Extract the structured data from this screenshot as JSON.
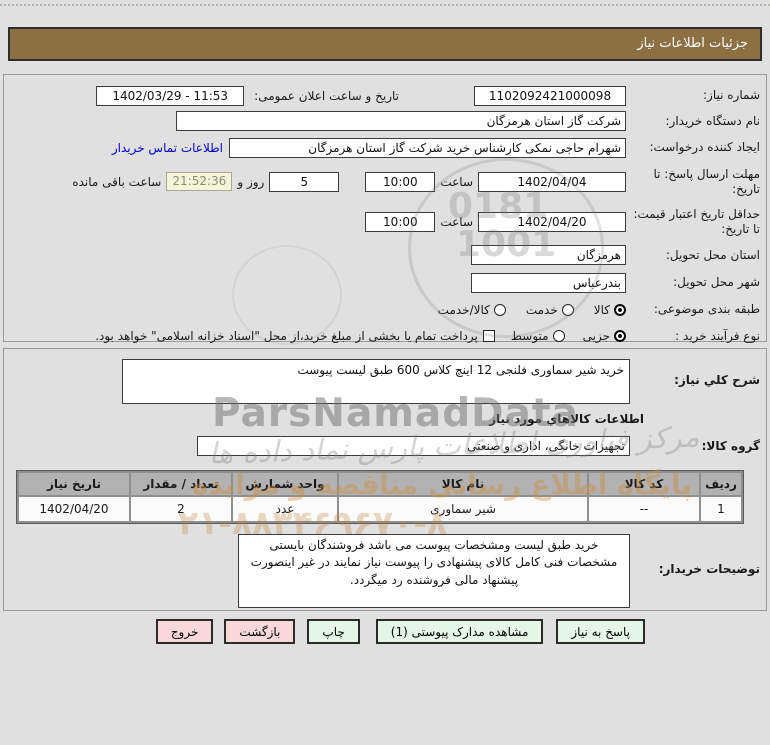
{
  "header": {
    "title": "جزئیات اطلاعات نیاز"
  },
  "need_info": {
    "need_number": {
      "label": "شماره نیاز:",
      "value": "1102092421000098"
    },
    "announce_datetime": {
      "label": "تاریخ و ساعت اعلان عمومی:",
      "value": "1402/03/29 - 11:53"
    },
    "buyer_org": {
      "label": "نام دستگاه خریدار:",
      "value": "شرکت گاز استان هرمزگان"
    },
    "request_creator": {
      "label": "ایجاد کننده درخواست:",
      "value": "شهرام حاجی نمکی کارشناس خرید شرکت گاز استان هرمزگان"
    },
    "contact_link": "اطلاعات تماس خریدار",
    "reply_deadline": {
      "label": "مهلت ارسال پاسخ: تا تاریخ:",
      "date": "1402/04/04",
      "hour_label": "ساعت",
      "time": "10:00",
      "days_remaining": "5",
      "days_label": "روز و",
      "countdown": "21:52:36",
      "countdown_label": "ساعت باقی مانده"
    },
    "price_validity": {
      "label": "حداقل تاریخ اعتبار قیمت: تا تاریخ:",
      "date": "1402/04/20",
      "hour_label": "ساعت",
      "time": "10:00"
    },
    "delivery_province": {
      "label": "استان محل تحویل:",
      "value": "هرمزگان"
    },
    "delivery_city": {
      "label": "شهر محل تحویل:",
      "value": "بندرعباس"
    },
    "subject_class": {
      "label": "طبقه بندی موضوعی:",
      "options": [
        {
          "label": "کالا",
          "selected": true
        },
        {
          "label": "خدمت",
          "selected": false
        },
        {
          "label": "کالا/خدمت",
          "selected": false
        }
      ]
    },
    "purchase_type": {
      "label": "نوع فرآیند خرید :",
      "options": [
        {
          "label": "جزیی",
          "selected": true
        },
        {
          "label": "متوسط",
          "selected": false
        }
      ],
      "treasury_checkbox_label": "پرداخت تمام یا بخشی از مبلغ خرید،از محل \"اسناد خزانه اسلامی\" خواهد بود.",
      "treasury_checked": false
    }
  },
  "need_desc": {
    "label": "شرح کلي نیاز:",
    "value": "خرید شیر سماوری فلنجی 12 اینچ کلاس 600 طبق لیست پیوست"
  },
  "goods_section": {
    "title": "اطلاعات کالاهاي مورد نیاز",
    "group": {
      "label": "گروه کالا:",
      "value": "تجهیزات خانگی، اداری و صنعتی"
    },
    "table": {
      "headers": [
        "ردیف",
        "کد کالا",
        "نام کالا",
        "واحد شمارش",
        "تعداد / مقدار",
        "تاریخ نیاز"
      ],
      "rows": [
        [
          "1",
          "--",
          "شیر سماوری",
          "عدد",
          "2",
          "1402/04/20"
        ]
      ]
    }
  },
  "buyer_notes": {
    "label": "توضیحات خریدار:",
    "value": "خرید طبق لیست ومشخصات پیوست می باشد فروشندگان بایستی مشخصات فنی کامل کالای پیشنهادی را پیوست نیاز نمایند در غیر اینصورت پیشنهاد مالی فروشنده رد میگردد."
  },
  "buttons": {
    "reply": "پاسخ به نیاز",
    "view_docs": "مشاهده مدارک پیوستی (1)",
    "print": "چاپ",
    "back": "بازگشت",
    "exit": "خروج"
  },
  "watermark": {
    "brand": "ParsNamadData",
    "script_line": "مرکز فناوری اطلاعات پارس نماد داده ها",
    "orange_line": "پایگاه اطلاع رسانی مناقصه و مزایده",
    "phone": "۲۱-۸۸۳۴۶۹۶۷۰-۸",
    "stamp_top": "0181",
    "stamp_bottom": "1001"
  },
  "colors": {
    "header_bg": "#8c6f42",
    "button_green": "#e6f6e6",
    "button_pink": "#f8d8d8",
    "link_blue": "#0000cc",
    "countdown_bg": "#f5f5dc"
  }
}
